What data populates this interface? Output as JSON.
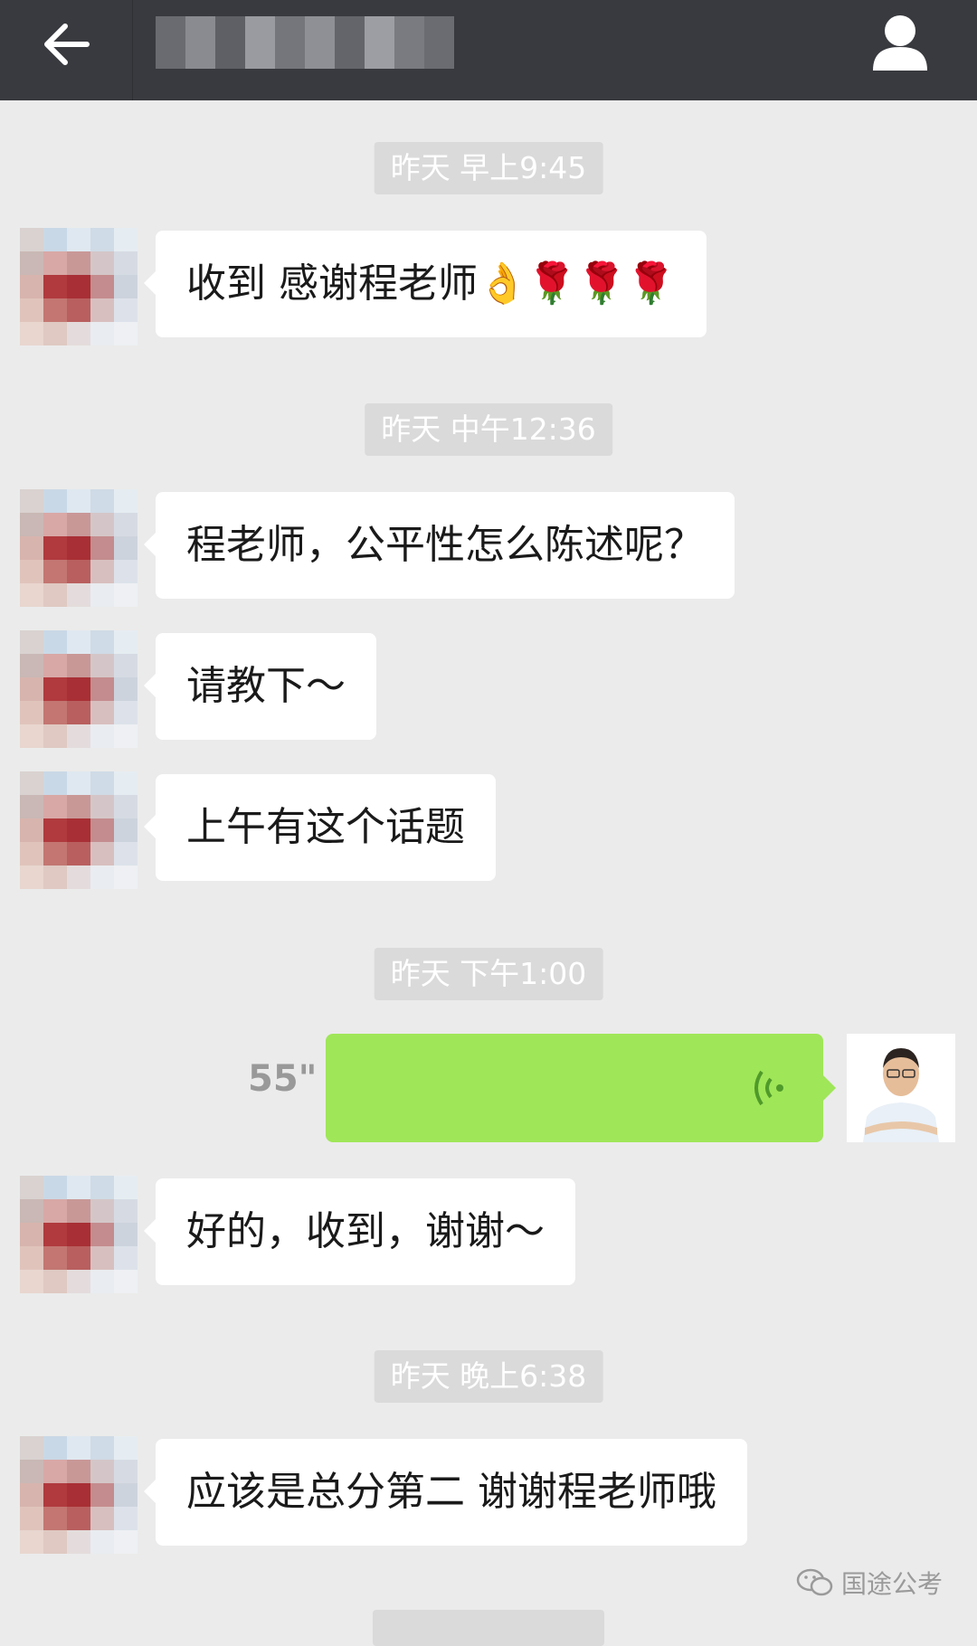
{
  "header": {
    "back_icon": "arrow-left-icon",
    "profile_icon": "person-icon",
    "title_blurred": true
  },
  "messages": [
    {
      "type": "timestamp",
      "text": "昨天 早上9:45"
    },
    {
      "type": "incoming",
      "text": "收到 感谢程老师👌🌹🌹🌹"
    },
    {
      "type": "timestamp",
      "text": "昨天 中午12:36"
    },
    {
      "type": "incoming",
      "text": "程老师，公平性怎么陈述呢？"
    },
    {
      "type": "incoming",
      "text": "请教下～"
    },
    {
      "type": "incoming",
      "text": "上午有这个话题"
    },
    {
      "type": "timestamp",
      "text": "昨天 下午1:00"
    },
    {
      "type": "outgoing-voice",
      "duration": "55\""
    },
    {
      "type": "incoming",
      "text": "好的，收到，谢谢～"
    },
    {
      "type": "timestamp",
      "text": "昨天 晚上6:38"
    },
    {
      "type": "incoming",
      "text": "应该是总分第二 谢谢程老师哦"
    }
  ],
  "watermark": {
    "text": "国途公考",
    "icon": "wechat-icon"
  },
  "colors": {
    "topbar": "#393a3f",
    "background": "#ebebeb",
    "outgoing_bubble": "#9fe658",
    "incoming_bubble": "#ffffff",
    "timestamp_bg": "#dadada"
  }
}
